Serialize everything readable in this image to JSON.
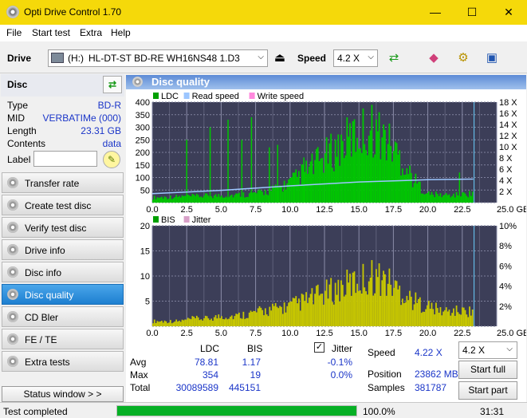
{
  "window": {
    "title": "Opti Drive Control 1.70",
    "minimize": "—",
    "maximize": "☐",
    "close": "✕"
  },
  "menu": [
    "File",
    "Start test",
    "Extra",
    "Help"
  ],
  "toolbar": {
    "drive_label": "Drive",
    "drive_letter": "(H:)",
    "drive_name": "HL-DT-ST BD-RE  WH16NS48 1.D3",
    "speed_label": "Speed",
    "speed_value": "4.2 X"
  },
  "disc": {
    "header": "Disc",
    "rows": [
      {
        "key": "Type",
        "value": "BD-R"
      },
      {
        "key": "MID",
        "value": "VERBATIMe (000)"
      },
      {
        "key": "Length",
        "value": "23.31 GB"
      },
      {
        "key": "Contents",
        "value": "data"
      }
    ],
    "label_key": "Label",
    "label_value": ""
  },
  "nav": [
    {
      "label": "Transfer rate",
      "active": false
    },
    {
      "label": "Create test disc",
      "active": false
    },
    {
      "label": "Verify test disc",
      "active": false
    },
    {
      "label": "Drive info",
      "active": false
    },
    {
      "label": "Disc info",
      "active": false
    },
    {
      "label": "Disc quality",
      "active": true
    },
    {
      "label": "CD Bler",
      "active": false
    },
    {
      "label": "FE / TE",
      "active": false
    },
    {
      "label": "Extra tests",
      "active": false
    }
  ],
  "status_window_btn": "Status window > >",
  "panel_title": "Disc quality",
  "chart_data": [
    {
      "type": "bar",
      "legend": [
        "LDC",
        "Read speed",
        "Write speed"
      ],
      "x_ticks": [
        "0.0",
        "2.5",
        "5.0",
        "7.5",
        "10.0",
        "12.5",
        "15.0",
        "17.5",
        "20.0",
        "22.5",
        "25.0 GB"
      ],
      "xlim": [
        0,
        25
      ],
      "y_ticks_left": [
        "400",
        "350",
        "300",
        "250",
        "200",
        "150",
        "100",
        "50"
      ],
      "ylim_left": [
        0,
        400
      ],
      "y_ticks_right": [
        "18 X",
        "16 X",
        "14 X",
        "12 X",
        "10 X",
        "8 X",
        "6 X",
        "4 X",
        "2 X"
      ],
      "ylim_right": [
        0,
        18
      ],
      "series": [
        {
          "name": "LDC",
          "color": "#00c800",
          "x": [
            0,
            1,
            2,
            3,
            4,
            5,
            6,
            7,
            8,
            9,
            10,
            11,
            12,
            13,
            14,
            15,
            16,
            17,
            18,
            19,
            20,
            21,
            22,
            23,
            23.3
          ],
          "values": [
            20,
            22,
            24,
            25,
            27,
            28,
            30,
            34,
            40,
            55,
            80,
            120,
            160,
            200,
            240,
            275,
            295,
            250,
            180,
            90,
            35,
            30,
            30,
            35,
            40
          ]
        },
        {
          "name": "Read speed",
          "color": "#9cc6ff",
          "x": [
            0,
            5,
            10,
            15,
            20,
            23.3
          ],
          "values": [
            1.6,
            2.2,
            3.0,
            3.7,
            4.1,
            4.22
          ]
        }
      ]
    },
    {
      "type": "bar",
      "legend": [
        "BIS",
        "Jitter"
      ],
      "x_ticks": [
        "0.0",
        "2.5",
        "5.0",
        "7.5",
        "10.0",
        "12.5",
        "15.0",
        "17.5",
        "20.0",
        "22.5",
        "25.0 GB"
      ],
      "xlim": [
        0,
        25
      ],
      "y_ticks_left": [
        "20",
        "15",
        "10",
        "5"
      ],
      "ylim_left": [
        0,
        20
      ],
      "y_ticks_right": [
        "10%",
        "8%",
        "6%",
        "4%",
        "2%"
      ],
      "ylim_right": [
        0,
        10
      ],
      "series": [
        {
          "name": "BIS",
          "color": "#c8c800",
          "x": [
            0,
            1,
            2,
            3,
            4,
            5,
            6,
            7,
            8,
            9,
            10,
            11,
            12,
            13,
            14,
            15,
            16,
            17,
            18,
            19,
            20,
            21,
            22,
            23,
            23.3
          ],
          "values": [
            1,
            1,
            1,
            1.5,
            1.5,
            2,
            2,
            2.5,
            3,
            3.5,
            4,
            5,
            6,
            7,
            8,
            9,
            10,
            9,
            7,
            5,
            4,
            3,
            3,
            3,
            3
          ]
        }
      ]
    }
  ],
  "stats": {
    "col_ldc": "LDC",
    "col_bis": "BIS",
    "rows": [
      {
        "label": "Avg",
        "ldc": "78.81",
        "bis": "1.17",
        "jitter": "-0.1%"
      },
      {
        "label": "Max",
        "ldc": "354",
        "bis": "19",
        "jitter": "0.0%"
      },
      {
        "label": "Total",
        "ldc": "30089589",
        "bis": "445151",
        "jitter": ""
      }
    ],
    "jitter_label": "Jitter",
    "speed_label": "Speed",
    "speed_value": "4.22 X",
    "position_label": "Position",
    "position_value": "23862 MB",
    "samples_label": "Samples",
    "samples_value": "381787",
    "speed_select": "4.2 X",
    "start_full": "Start full",
    "start_part": "Start part"
  },
  "status": {
    "text": "Test completed",
    "progress": 100.0,
    "progress_text": "100.0%",
    "time": "31:31"
  }
}
